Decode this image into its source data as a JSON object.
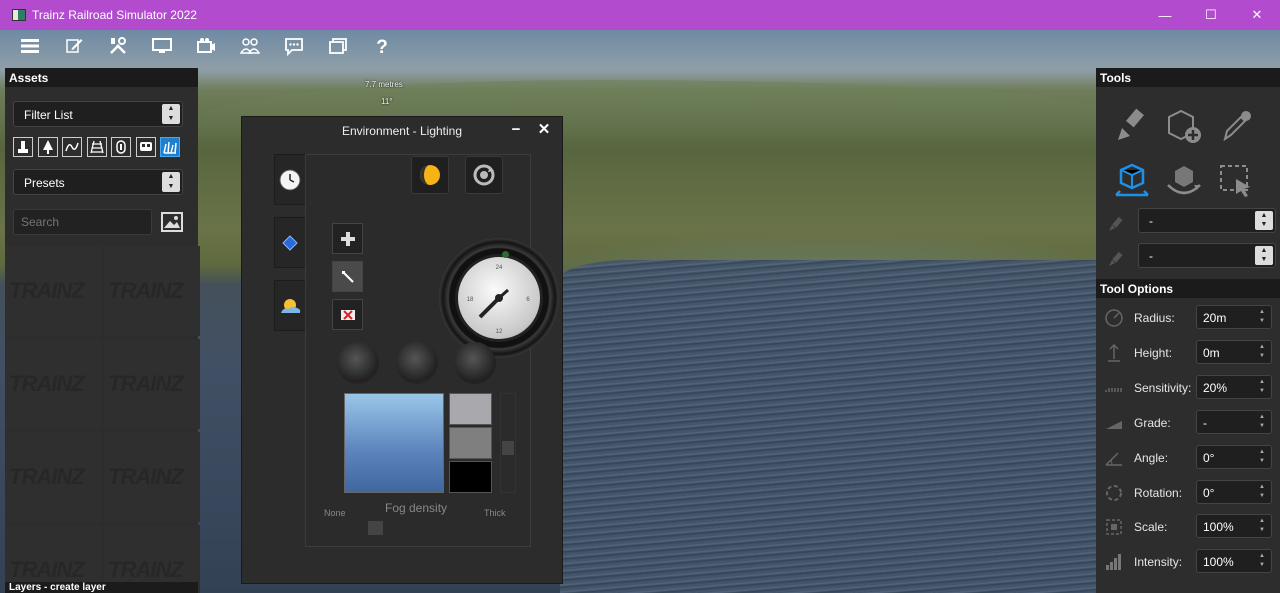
{
  "window": {
    "title": "Trainz Railroad Simulator 2022"
  },
  "toolbar": {
    "items": [
      "menu-icon",
      "edit-icon",
      "tools-icon",
      "display-icon",
      "camera-icon",
      "multiplayer-icon",
      "chat-icon",
      "layers-icon",
      "help-icon"
    ]
  },
  "hud": {
    "distance": "7.7 metres",
    "angle": "11°"
  },
  "assets": {
    "title": "Assets",
    "filter_select": "Filter List",
    "presets_select": "Presets",
    "search_placeholder": "Search",
    "tile_watermark": "TRAINZ",
    "layers_label": "Layers - create layer"
  },
  "env_dialog": {
    "title": "Environment - Lighting",
    "minimize": "−",
    "close": "✕",
    "fog_label": "Fog density",
    "fog_min": "None",
    "fog_max": "Thick",
    "swatch_colors": [
      "#a9a9ad",
      "#7f7f80",
      "#000000"
    ],
    "clock_time": "13:08"
  },
  "tools": {
    "title": "Tools",
    "brush_select_1": "-",
    "brush_select_2": "-",
    "options_title": "Tool Options",
    "options": [
      {
        "label": "Radius:",
        "value": "20m",
        "icon": "radius-icon"
      },
      {
        "label": "Height:",
        "value": "0m",
        "icon": "height-icon"
      },
      {
        "label": "Sensitivity:",
        "value": "20%",
        "icon": "sensitivity-icon"
      },
      {
        "label": "Grade:",
        "value": "-",
        "icon": "grade-icon"
      },
      {
        "label": "Angle:",
        "value": "0°",
        "icon": "angle-icon"
      },
      {
        "label": "Rotation:",
        "value": "0°",
        "icon": "rotation-icon"
      },
      {
        "label": "Scale:",
        "value": "100%",
        "icon": "scale-icon"
      },
      {
        "label": "Intensity:",
        "value": "100%",
        "icon": "intensity-icon"
      }
    ]
  },
  "colors": {
    "titlebar": "#b34bcf",
    "accent": "#1e90e6"
  }
}
